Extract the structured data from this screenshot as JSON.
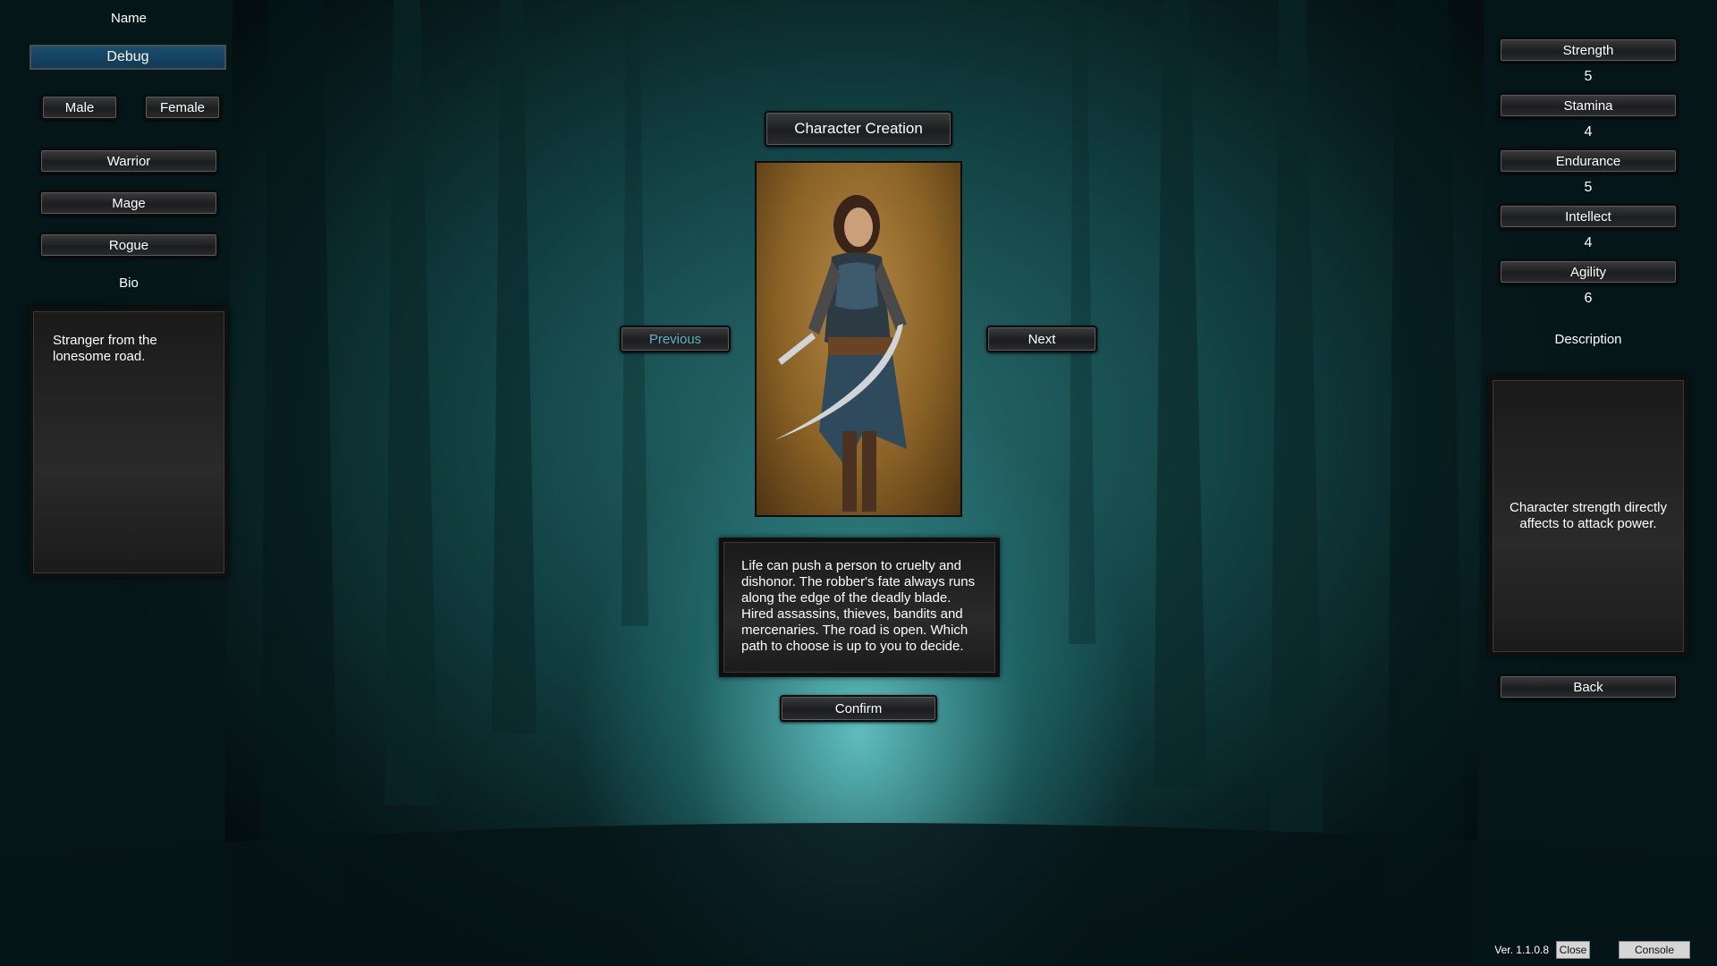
{
  "left": {
    "name_label": "Name",
    "name_value": "Debug",
    "gender_male": "Male",
    "gender_female": "Female",
    "classes": [
      "Warrior",
      "Mage",
      "Rogue"
    ],
    "bio_label": "Bio",
    "bio_text": "Stranger from the lonesome road."
  },
  "center": {
    "title": "Character Creation",
    "previous": "Previous",
    "next": "Next",
    "class_description": "Life can push a person to cruelty and dishonor. The robber's fate always runs along the edge of the deadly blade. Hired assassins, thieves, bandits and mercenaries. The road is open. Which path to choose is up to you to decide.",
    "confirm": "Confirm"
  },
  "right": {
    "stats": [
      {
        "label": "Strength",
        "value": "5"
      },
      {
        "label": "Stamina",
        "value": "4"
      },
      {
        "label": "Endurance",
        "value": "5"
      },
      {
        "label": "Intellect",
        "value": "4"
      },
      {
        "label": "Agility",
        "value": "6"
      }
    ],
    "description_label": "Description",
    "description_text": "Character strength directly affects to attack power.",
    "back": "Back"
  },
  "footer": {
    "version": "Ver. 1.1.0.8",
    "close": "Close",
    "console": "Console"
  },
  "colors": {
    "accent_field": "#1b4d6e",
    "previous_text": "#5eb3c6",
    "background": "#134446"
  }
}
